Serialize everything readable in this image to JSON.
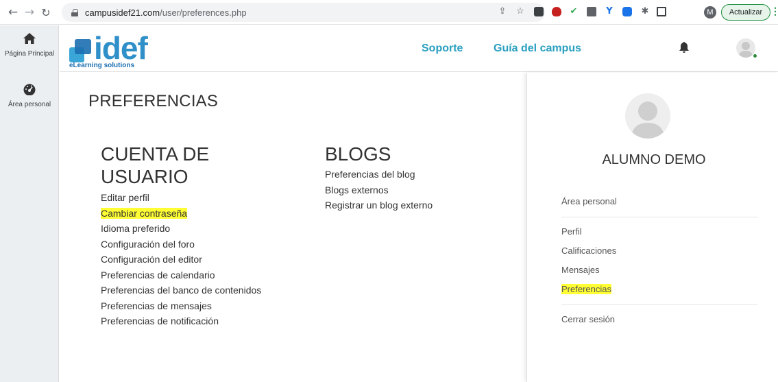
{
  "browser": {
    "url_domain": "campusidef21.com",
    "url_path": "/user/preferences.php",
    "profile_initial": "M",
    "update_label": "Actualizar",
    "menu_glyph": "⋮"
  },
  "sidebar": {
    "items": [
      {
        "icon": "home-icon",
        "label": "Página Principal"
      },
      {
        "icon": "dashboard-icon",
        "label": "Área personal"
      }
    ]
  },
  "header": {
    "logo_word": "idef",
    "logo_sub": "eLearning solutions",
    "links": [
      "Soporte",
      "Guía del campus"
    ]
  },
  "main": {
    "title": "PREFERENCIAS",
    "sections": [
      {
        "title_line1": "CUENTA DE",
        "title_line2": "USUARIO",
        "links": [
          "Editar perfil",
          "Cambiar contraseña",
          "Idioma preferido",
          "Configuración del foro",
          "Configuración del editor",
          "Preferencias de calendario",
          "Preferencias del banco de contenidos",
          "Preferencias de mensajes",
          "Preferencias de notificación"
        ]
      },
      {
        "title": "BLOGS",
        "links": [
          "Preferencias del blog",
          "Blogs externos",
          "Registrar un blog externo"
        ]
      }
    ]
  },
  "drawer": {
    "user_name": "ALUMNO DEMO",
    "links": [
      "Área personal",
      "Perfil",
      "Calificaciones",
      "Mensajes",
      "Preferencias",
      "Cerrar sesión"
    ]
  },
  "colors": {
    "highlight": "#ffff33",
    "link_accent": "#2a9fc0",
    "logo_blue": "#2f8fc8",
    "update_green": "#1e8e3e"
  }
}
